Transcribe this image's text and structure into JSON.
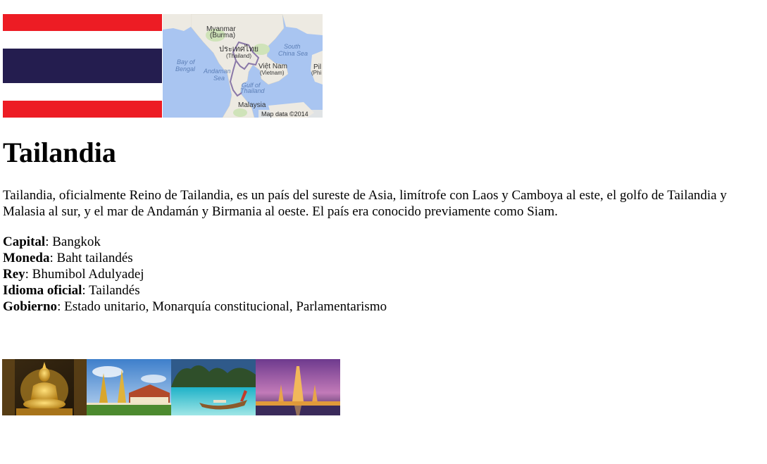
{
  "map": {
    "labels": {
      "myanmar": "Myanmar",
      "burma": "(Burma)",
      "thai_native": "ประเทศไทย",
      "thailand": "(Thailand)",
      "south": "South",
      "china_sea": "China Sea",
      "bay_of": "Bay of",
      "bengal": "Bengal",
      "andaman": "Andaman",
      "sea": "Sea",
      "viet_nam": "Việt Nam",
      "vietnam": "(Vietnam)",
      "gulf_of": "Gulf of",
      "thailand_gulf": "Thailand",
      "malaysia": "Malaysia",
      "pi": "Pil",
      "phi": "(Phi",
      "credit": "Map data ©2014"
    }
  },
  "article": {
    "title": "Tailandia",
    "intro": "Tailandia, oficialmente Reino de Tailandia, es un país del sureste de Asia, limítrofe con Laos y Camboya al este, el golfo de Tailandia y Malasia al sur, y el mar de Andamán y Birmania al oeste. El país era conocido previamente como Siam.",
    "facts": [
      {
        "label": "Capital",
        "value": ": Bangkok"
      },
      {
        "label": "Moneda",
        "value": ": Baht tailandés"
      },
      {
        "label": "Rey",
        "value": ": Bhumibol Adulyadej"
      },
      {
        "label": "Idioma oficial",
        "value": ": Tailandés"
      },
      {
        "label": "Gobierno",
        "value": ": Estado unitario, Monarquía constitucional, Parlamentarismo"
      }
    ]
  },
  "colors": {
    "flag_red": "#ED1C24",
    "flag_white": "#FFFFFF",
    "flag_blue": "#241D4F",
    "map_water": "#A9C5F1",
    "map_land": "#EDEAE2",
    "map_border": "#8A78A8"
  }
}
